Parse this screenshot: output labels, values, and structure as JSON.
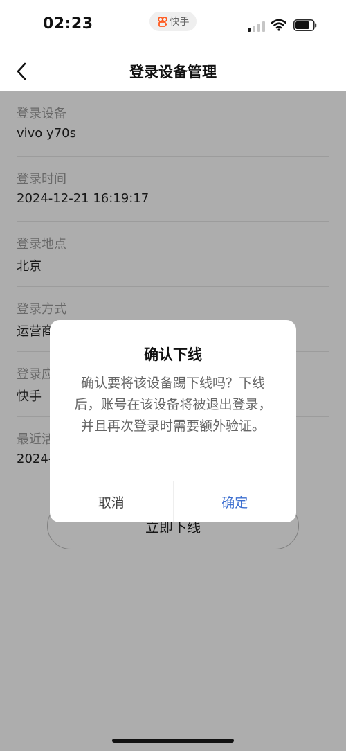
{
  "status_bar": {
    "time": "02:23",
    "app_badge": "快手"
  },
  "nav": {
    "title": "登录设备管理",
    "back_icon": "chevron-left-icon"
  },
  "info_items": [
    {
      "label": "登录设备",
      "value": "vivo y70s"
    },
    {
      "label": "登录时间",
      "value": "2024-12-21 16:19:17"
    },
    {
      "label": "登录地点",
      "value": "北京"
    },
    {
      "label": "登录方式",
      "value": "运营商"
    },
    {
      "label": "登录应",
      "value": "快手"
    },
    {
      "label": "最近活",
      "value": "2024-"
    }
  ],
  "offline_button": {
    "label": "立即下线"
  },
  "dialog": {
    "title": "确认下线",
    "message": "确认要将该设备踢下线吗？下线后，账号在该设备将被退出登录，并且再次登录时需要额外验证。",
    "cancel_label": "取消",
    "confirm_label": "确定"
  },
  "colors": {
    "accent": "#3d6fd0",
    "overlay": "rgba(0,0,0,0.32)",
    "label_gray": "#9a9a9a",
    "brand_orange": "#ff5a1f"
  }
}
